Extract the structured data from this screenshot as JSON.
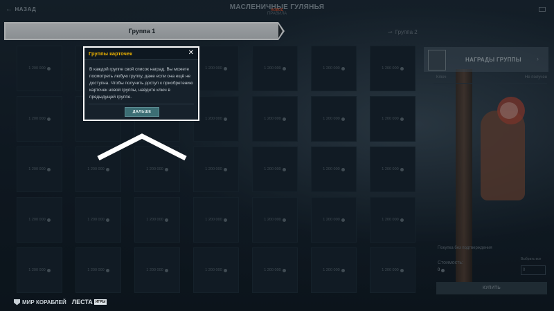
{
  "topbar": {
    "back_label": "НАЗАД",
    "title": "МАСЛЕНИЧНЫЕ ГУЛЯНЬЯ",
    "rules_label": "ПРАВИЛА",
    "new_badge": "НОВОЕ"
  },
  "tabs": [
    {
      "label": "Группа  1",
      "active": true
    },
    {
      "label": "Группа  2",
      "active": false
    }
  ],
  "cards": [
    "1 200 000",
    "1 200 000",
    "1 200 000",
    "1 200 000",
    "1 200 000",
    "1 200 000",
    "1 200 000",
    "1 200 000",
    "1 200 000",
    "1 200 000",
    "1 200 000",
    "1 200 000",
    "1 200 000",
    "1 200 000",
    "1 200 000",
    "1 200 000",
    "1 200 000",
    "1 200 000",
    "1 200 000",
    "1 200 000",
    "1 200 000",
    "1 200 000",
    "1 200 000",
    "1 200 000",
    "1 200 000",
    "1 200 000",
    "1 200 000",
    "1 200 000",
    "1 200 000",
    "1 200 000",
    "1 200 000",
    "1 200 000",
    "1 200 000",
    "1 200 000",
    "1 200 000"
  ],
  "popup": {
    "title": "Группы карточек",
    "text": "В каждой группе свой список наград. Вы можете посмотреть любую группу, даже если она ещё не доступна. Чтобы получить доступ к приобретению карточек новой группы, найдите ключ в предыдущей группе.",
    "button": "ДАЛЬШЕ"
  },
  "rewards_panel": {
    "title": "НАГРАДЫ ГРУППЫ",
    "key_label": "Ключ",
    "key_status": "Не получен",
    "purchase_toggle": "Покупка без подтверждения",
    "select_all": "Выбрать все",
    "cost_label": "Стоимость:",
    "cost_value": "0",
    "quantity": "0",
    "buy_button": "КУПИТЬ"
  },
  "logos": {
    "wows": "МИР КОРАБЛЕЙ",
    "lesta": "ЛЕСТА",
    "lesta_tag": "ИГРЫ"
  }
}
